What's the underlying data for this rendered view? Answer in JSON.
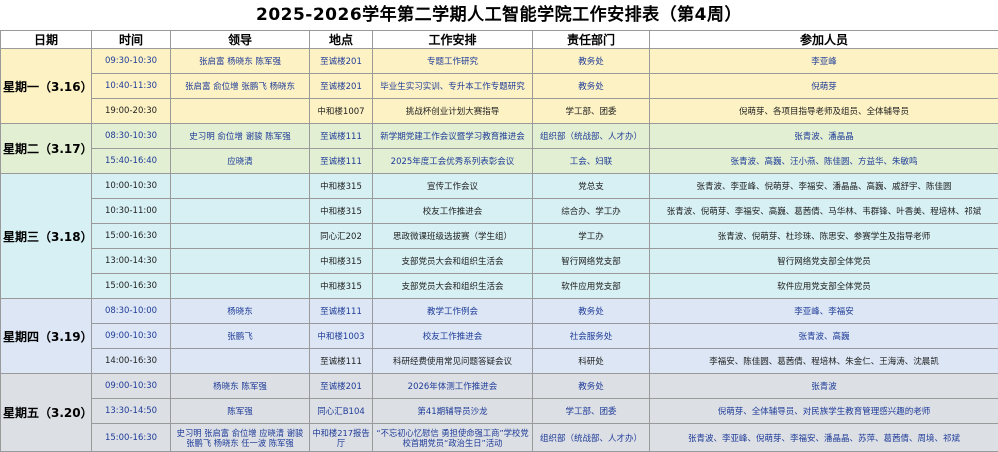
{
  "title": "2025-2026学年第二学期人工智能学院工作安排表（第4周）",
  "headers": {
    "date": "日期",
    "time": "时间",
    "leader": "领导",
    "place": "地点",
    "task": "工作安排",
    "dept": "责任部门",
    "people": "参加人员"
  },
  "days": [
    {
      "label": "星期一（3.16）",
      "rows": [
        {
          "time": "09:30-10:30",
          "leader": "张启富 杨晓东 陈军强",
          "place": "至诚楼201",
          "task": "专题工作研究",
          "dept": "教务处",
          "people": "李亚峰"
        },
        {
          "time": "10:40-11:30",
          "leader": "张启富 俞位增 张鹏飞 杨晓东",
          "place": "至诚楼201",
          "task": "毕业生实习实训、专升本工作专题研究",
          "dept": "教务处",
          "people": "倪萌芽"
        },
        {
          "time": "19:00-20:30",
          "leader": "",
          "place": "中和楼1007",
          "task": "挑战杯创业计划大赛指导",
          "dept": "学工部、团委",
          "people": "倪萌芽、各项目指导老师及组员、全体辅导员"
        }
      ]
    },
    {
      "label": "星期二（3.17）",
      "rows": [
        {
          "time": "08:30-10:30",
          "leader": "史习明 俞位增 谢骏 陈军强",
          "place": "至诚楼111",
          "task": "新学期党建工作会议暨学习教育推进会",
          "dept": "组织部（统战部、人才办）",
          "people": "张青波、潘晶晶"
        },
        {
          "time": "15:40-16:40",
          "leader": "应晓清",
          "place": "至诚楼111",
          "task": "2025年度工会优秀系列表彰会议",
          "dept": "工会、妇联",
          "people": "张青波、高巍、汪小燕、陈佳圆、方益华、朱敏鸣"
        }
      ]
    },
    {
      "label": "星期三（3.18）",
      "rows": [
        {
          "time": "10:00-10:30",
          "leader": "",
          "place": "中和楼315",
          "task": "宣传工作会议",
          "dept": "党总支",
          "people": "张青波、李亚峰、倪萌芽、李福安、潘晶晶、高巍、戚舒宇、陈佳圆"
        },
        {
          "time": "10:30-11:00",
          "leader": "",
          "place": "中和楼315",
          "task": "校友工作推进会",
          "dept": "综合办、学工办",
          "people": "张青波、倪萌芽、李福安、高巍、葛茜倩、马华林、韦群锋、叶香美、程培林、祁斌"
        },
        {
          "time": "15:00-16:30",
          "leader": "",
          "place": "同心汇202",
          "task": "思政微课班级选拔赛（学生组）",
          "dept": "学工办",
          "people": "张青波、倪萌芽、杜珍珠、陈思安、参赛学生及指导老师"
        },
        {
          "time": "13:00-14:30",
          "leader": "",
          "place": "中和楼315",
          "task": "支部党员大会和组织生活会",
          "dept": "智行网络党支部",
          "people": "智行网络党支部全体党员"
        },
        {
          "time": "15:00-16:30",
          "leader": "",
          "place": "中和楼315",
          "task": "支部党员大会和组织生活会",
          "dept": "软件应用党支部",
          "people": "软件应用党支部全体党员"
        }
      ]
    },
    {
      "label": "星期四（3.19）",
      "rows": [
        {
          "time": "08:30-10:00",
          "leader": "杨晓东",
          "place": "至诚楼111",
          "task": "教学工作例会",
          "dept": "教务处",
          "people": "李亚峰、李福安"
        },
        {
          "time": "09:00-10:30",
          "leader": "张鹏飞",
          "place": "中和楼1003",
          "task": "校友工作推进会",
          "dept": "社会服务处",
          "people": "张青波、高巍"
        },
        {
          "time": "14:00-16:30",
          "leader": "",
          "place": "至诚楼111",
          "task": "科研经费使用常见问题答疑会议",
          "dept": "科研处",
          "people": "李福安、陈佳圆、葛茜倩、程培林、朱金仁、王海涛、沈晨凯"
        }
      ]
    },
    {
      "label": "星期五（3.20）",
      "rows": [
        {
          "time": "09:00-10:30",
          "leader": "杨晓东 陈军强",
          "place": "至诚楼201",
          "task": "2026年体测工作推进会",
          "dept": "教务处",
          "people": "张青波"
        },
        {
          "time": "13:30-14:50",
          "leader": "陈军强",
          "place": "同心汇B104",
          "task": "第41期辅导员沙龙",
          "dept": "学工部、团委",
          "people": "倪萌芽、全体辅导员、对民族学生教育管理感兴趣的老师"
        },
        {
          "time": "15:00-16:30",
          "leader": "史习明 张启富 俞位增 应晓清 谢骏 张鹏飞 杨晓东 任一波 陈军强",
          "place": "中和楼217报告厅",
          "task": "“不忘初心忆慰信 勇担使命强工商”学校党校首期党员“政治生日”活动",
          "dept": "组织部（统战部、人才办）",
          "people": "张青波、李亚峰、倪萌芽、李福安、潘晶晶、苏萍、葛茜倩、周境、祁斌"
        }
      ]
    }
  ]
}
